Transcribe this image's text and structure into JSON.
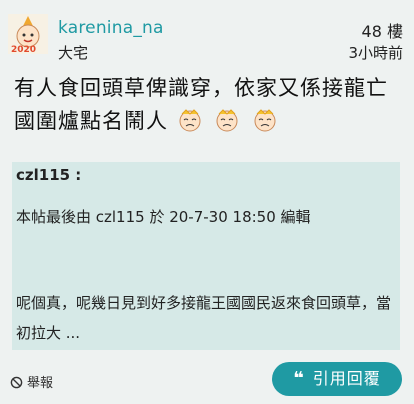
{
  "post": {
    "username": "karenina_na",
    "user_title": "大宅",
    "floor": "48 樓",
    "time": "3小時前",
    "title": "有人食回頭草俾識穿，依家又係接龍亡國圍爐點名鬧人"
  },
  "quote": {
    "author": "czl115 :",
    "edit_note": "本帖最後由 czl115 於 20-7-30 18:50 編輯",
    "text": "呢個真，呢幾日見到好多接龍王國國民返來食回頭草，當初拉大 ..."
  },
  "footer": {
    "report_label": "舉報",
    "reply_label": "引用回覆"
  },
  "colors": {
    "accent": "#1f9aa3",
    "quote_bg": "#d6e9e7",
    "page_bg": "#eef2f1"
  }
}
